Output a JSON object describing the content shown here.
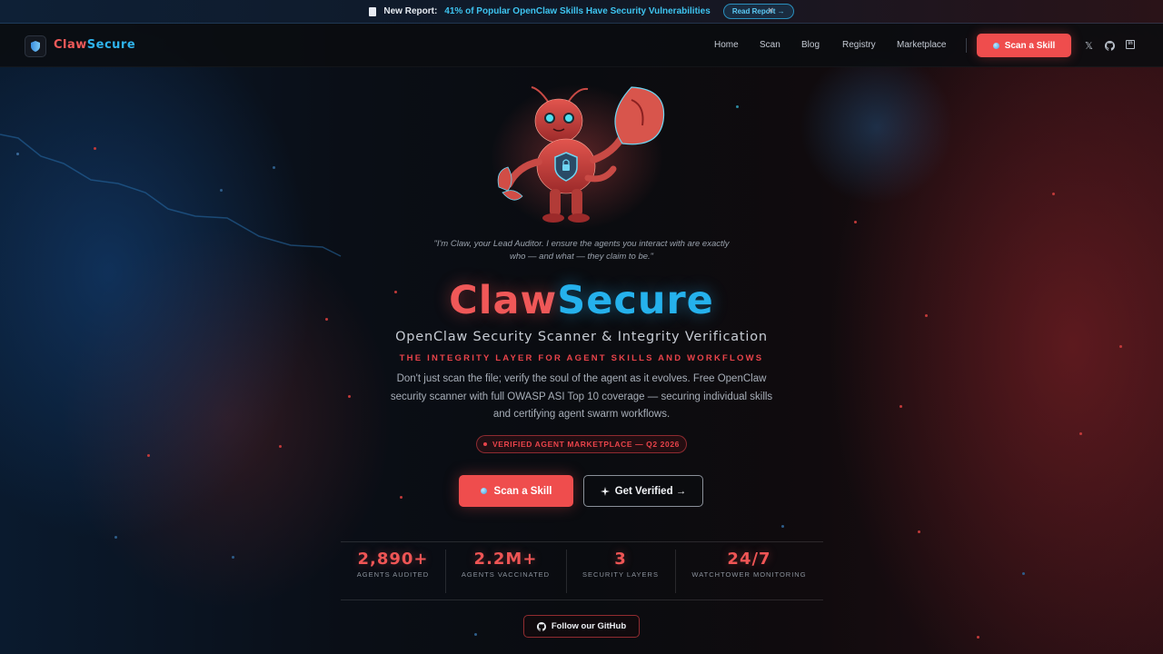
{
  "announcement": {
    "lead": "New Report:",
    "highlight": "41% of Popular OpenClaw Skills Have Security Vulnerabilities",
    "cta": "Read Report →",
    "close": "×"
  },
  "nav": {
    "brand_a": "Claw",
    "brand_b": "Secure",
    "links": [
      "Home",
      "Scan",
      "Blog",
      "Registry",
      "Marketplace"
    ],
    "cta": "Scan a Skill",
    "social": {
      "x": "𝕏",
      "github": "github-icon",
      "linkedin": "in"
    }
  },
  "hero": {
    "quote": "\"I'm Claw, your Lead Auditor. I ensure the agents you interact with are exactly who — and what — they claim to be.\"",
    "title_a": "Claw",
    "title_b": "Secure",
    "subtitle": "OpenClaw Security Scanner & Integrity Verification",
    "tagline": "THE INTEGRITY LAYER FOR AGENT SKILLS AND WORKFLOWS",
    "description": "Don't just scan the file; verify the soul of the agent as it evolves. Free OpenClaw security scanner with full OWASP ASI Top 10 coverage — securing individual skills and certifying agent swarm workflows.",
    "badge": "VERIFIED AGENT MARKETPLACE — Q2 2026",
    "primary_cta": "Scan a Skill",
    "secondary_cta": "Get Verified →"
  },
  "stats": [
    {
      "value": "2,890+",
      "label": "AGENTS AUDITED"
    },
    {
      "value": "2.2M+",
      "label": "AGENTS VACCINATED"
    },
    {
      "value": "3",
      "label": "SECURITY LAYERS"
    },
    {
      "value": "24/7",
      "label": "WATCHTOWER MONITORING"
    }
  ],
  "github_cta": "Follow our GitHub",
  "colors": {
    "red": "#ef4d4d",
    "blue": "#25b1ec",
    "bg": "#0a0c10"
  }
}
